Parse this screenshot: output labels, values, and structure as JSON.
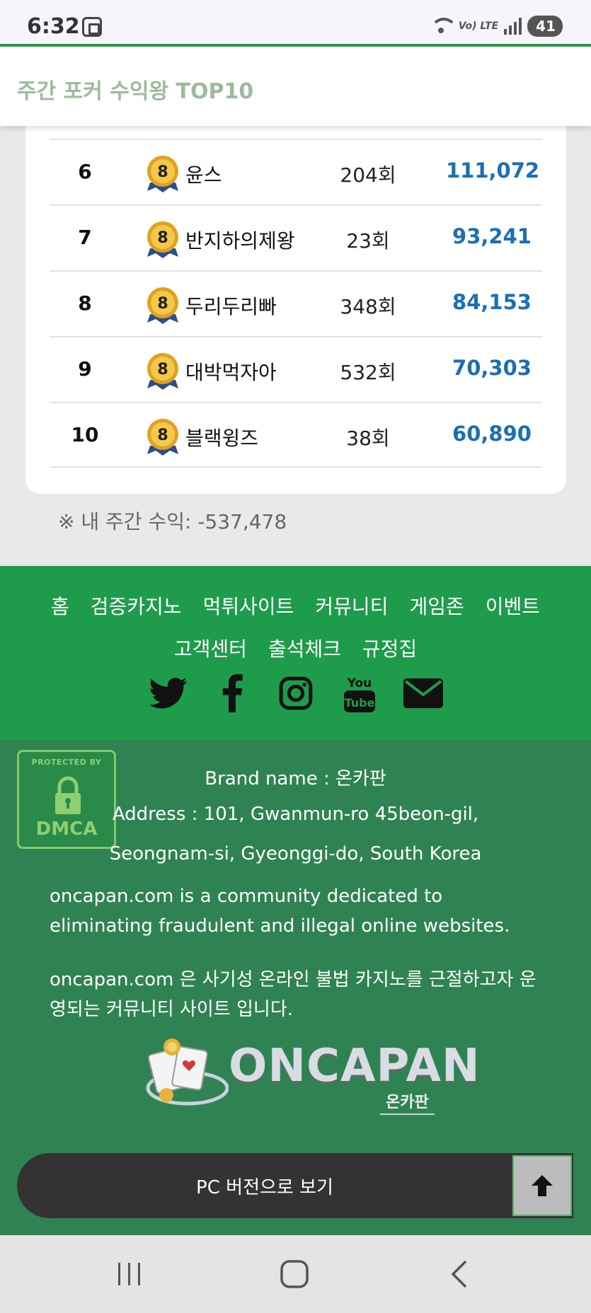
{
  "status_bar": {
    "time": "6:32",
    "network": "Vo) LTE",
    "battery": "41"
  },
  "header": {
    "title": "주간 포커 수익왕 TOP10"
  },
  "ranking": {
    "rows": [
      {
        "rank": "6",
        "medal": "8",
        "name": "윤스",
        "games": "204회",
        "profit": "111,072"
      },
      {
        "rank": "7",
        "medal": "8",
        "name": "반지하의제왕",
        "games": "23회",
        "profit": "93,241"
      },
      {
        "rank": "8",
        "medal": "8",
        "name": "두리두리빠",
        "games": "348회",
        "profit": "84,153"
      },
      {
        "rank": "9",
        "medal": "8",
        "name": "대박먹자아",
        "games": "532회",
        "profit": "70,303"
      },
      {
        "rank": "10",
        "medal": "8",
        "name": "블랙윙즈",
        "games": "38회",
        "profit": "60,890"
      }
    ],
    "my_profit": "※ 내 주간 수익: -537,478"
  },
  "footer_nav": {
    "links": [
      "홈",
      "검증카지노",
      "먹튀사이트",
      "커뮤니티",
      "게임존",
      "이벤트",
      "고객센터",
      "출석체크",
      "규정집"
    ],
    "social_icons": [
      "twitter-icon",
      "facebook-icon",
      "instagram-icon",
      "youtube-icon",
      "email-icon"
    ],
    "youtube_top": "You",
    "youtube_bottom": "Tube"
  },
  "info": {
    "dmca_top": "PROTECTED BY",
    "dmca_label": "DMCA",
    "brand": "Brand name : 온카판",
    "address_1": "Address : 101, Gwanmun-ro 45beon-gil,",
    "address_2": "Seongnam-si, Gyeonggi-do, South Korea",
    "desc_en": "oncapan.com is a community dedicated to eliminating fraudulent and illegal online websites.",
    "desc_ko": "oncapan.com 은 사기성 온라인 불법 카지노를 근절하고자 운영되는 커뮤니티 사이트 입니다.",
    "logo_text": "ONCAPAN",
    "logo_sub": "온카판"
  },
  "pc_version": {
    "label": "PC 버전으로 보기"
  },
  "colors": {
    "brand_green": "#1f9c4b",
    "dark_green": "#2f8352",
    "profit_blue": "#1c6fb2"
  }
}
